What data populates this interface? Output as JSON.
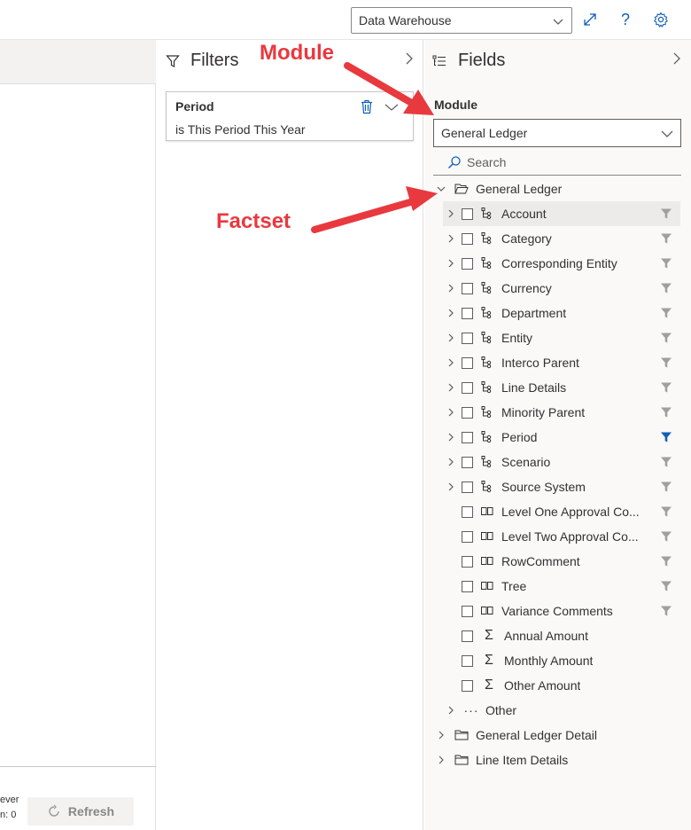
{
  "topbar": {
    "datasource_value": "Data Warehouse",
    "icons": [
      "expand-icon",
      "help-icon",
      "settings-icon"
    ]
  },
  "left_footer": {
    "line1": "ever",
    "line2": "n: 0",
    "refresh_label": "Refresh"
  },
  "filters": {
    "title": "Filters",
    "card": {
      "name": "Period",
      "value": "is This Period This Year"
    }
  },
  "fields": {
    "title": "Fields",
    "module_label": "Module",
    "module_value": "General Ledger",
    "search_placeholder": "Search",
    "root_folder": "General Ledger",
    "items": [
      {
        "label": "Account",
        "kind": "hierarchy",
        "expandable": true,
        "filter": "inactive",
        "selected": true
      },
      {
        "label": "Category",
        "kind": "hierarchy",
        "expandable": true,
        "filter": "inactive"
      },
      {
        "label": "Corresponding Entity",
        "kind": "hierarchy",
        "expandable": true,
        "filter": "inactive"
      },
      {
        "label": "Currency",
        "kind": "hierarchy",
        "expandable": true,
        "filter": "inactive"
      },
      {
        "label": "Department",
        "kind": "hierarchy",
        "expandable": true,
        "filter": "inactive"
      },
      {
        "label": "Entity",
        "kind": "hierarchy",
        "expandable": true,
        "filter": "inactive"
      },
      {
        "label": "Interco Parent",
        "kind": "hierarchy",
        "expandable": true,
        "filter": "inactive"
      },
      {
        "label": "Line Details",
        "kind": "hierarchy",
        "expandable": true,
        "filter": "inactive"
      },
      {
        "label": "Minority Parent",
        "kind": "hierarchy",
        "expandable": true,
        "filter": "inactive"
      },
      {
        "label": "Period",
        "kind": "hierarchy",
        "expandable": true,
        "filter": "active"
      },
      {
        "label": "Scenario",
        "kind": "hierarchy",
        "expandable": true,
        "filter": "inactive"
      },
      {
        "label": "Source System",
        "kind": "hierarchy",
        "expandable": true,
        "filter": "inactive"
      },
      {
        "label": "Level One Approval Co...",
        "kind": "attribute",
        "expandable": false,
        "filter": "inactive"
      },
      {
        "label": "Level Two Approval Co...",
        "kind": "attribute",
        "expandable": false,
        "filter": "inactive"
      },
      {
        "label": "RowComment",
        "kind": "attribute",
        "expandable": false,
        "filter": "inactive"
      },
      {
        "label": "Tree",
        "kind": "attribute",
        "expandable": false,
        "filter": "inactive"
      },
      {
        "label": "Variance Comments",
        "kind": "attribute",
        "expandable": false,
        "filter": "inactive"
      },
      {
        "label": "Annual Amount",
        "kind": "measure",
        "expandable": false,
        "filter": "none"
      },
      {
        "label": "Monthly Amount",
        "kind": "measure",
        "expandable": false,
        "filter": "none"
      },
      {
        "label": "Other Amount",
        "kind": "measure",
        "expandable": false,
        "filter": "none"
      }
    ],
    "other_label": "Other",
    "other_folders": [
      "General Ledger Detail",
      "Line Item Details"
    ]
  },
  "annotations": {
    "module": "Module",
    "factset": "Factset",
    "color": "#e8393f"
  },
  "colors": {
    "accent": "#0f5fb8",
    "filter_active": "#0f5fb8",
    "filter_inactive": "#a19f9d"
  }
}
